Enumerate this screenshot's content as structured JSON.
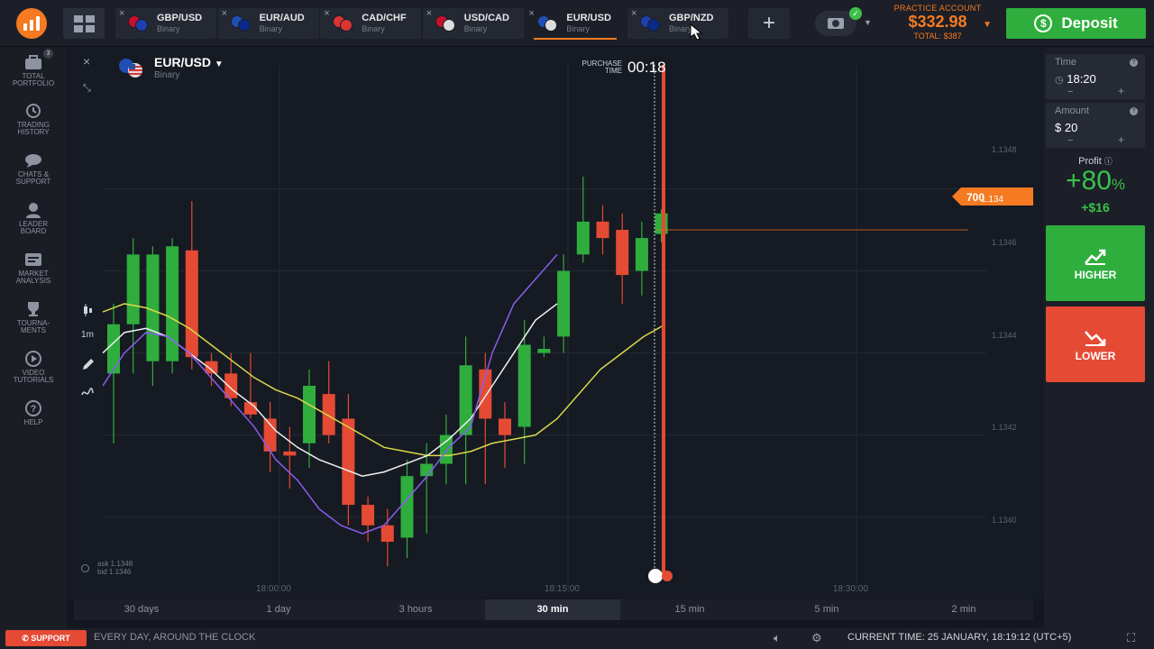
{
  "topbar": {
    "tabs": [
      {
        "name": "GBP/USD",
        "type": "Binary",
        "active": false
      },
      {
        "name": "EUR/AUD",
        "type": "Binary",
        "active": false
      },
      {
        "name": "CAD/CHF",
        "type": "Binary",
        "active": false
      },
      {
        "name": "USD/CAD",
        "type": "Binary",
        "active": false
      },
      {
        "name": "EUR/USD",
        "type": "Binary",
        "active": true
      },
      {
        "name": "GBP/NZD",
        "type": "Binary",
        "active": false
      }
    ],
    "close_glyph": "×",
    "plus_glyph": "+",
    "account": {
      "label": "PRACTICE ACCOUNT",
      "balance": "$332.98",
      "total": "TOTAL: $387"
    },
    "deposit_label": "Deposit"
  },
  "sidebar": {
    "items": [
      {
        "label": "TOTAL\nPORTFOLIO",
        "icon": "portfolio-icon",
        "badge": "3"
      },
      {
        "label": "TRADING\nHISTORY",
        "icon": "history-icon"
      },
      {
        "label": "CHATS &\nSUPPORT",
        "icon": "chat-icon"
      },
      {
        "label": "LEADER\nBOARD",
        "icon": "leaderboard-icon"
      },
      {
        "label": "MARKET\nANALYSIS",
        "icon": "market-analysis-icon"
      },
      {
        "label": "TOURNA-\nMENTS",
        "icon": "trophy-icon"
      },
      {
        "label": "VIDEO\nTUTORIALS",
        "icon": "play-icon"
      },
      {
        "label": "HELP",
        "icon": "help-icon"
      }
    ]
  },
  "chart_header": {
    "pair": "EUR/USD",
    "type": "Binary",
    "purchase_time_label": "PURCHASE\nTIME",
    "countdown": "00:18",
    "tool_timeframe": "1m",
    "ask": "ask 1.1348",
    "bid": "bid 1.1346",
    "current_price_prefix": "1.134",
    "current_price_suffix": "700"
  },
  "colors": {
    "up": "#2fae3d",
    "down": "#e44a34",
    "accent": "#f57a21",
    "ma_yellow": "#d9d94a",
    "ma_white": "#f0f0f0",
    "ma_purple": "#8a5cf0"
  },
  "chart_data": {
    "type": "candlestick",
    "x_ticks": [
      "18:00:00",
      "18:15:00",
      "18:30:00"
    ],
    "y_ticks": [
      "1.1348",
      "1.1346",
      "1.1344",
      "1.1342",
      "1.1340"
    ],
    "ylim": [
      1.13385,
      1.13508
    ],
    "candles": [
      {
        "o": 1.13435,
        "h": 1.13452,
        "l": 1.13418,
        "c": 1.13447
      },
      {
        "o": 1.13447,
        "h": 1.13468,
        "l": 1.13435,
        "c": 1.13464
      },
      {
        "o": 1.13438,
        "h": 1.13466,
        "l": 1.13432,
        "c": 1.13464
      },
      {
        "o": 1.13438,
        "h": 1.13468,
        "l": 1.13435,
        "c": 1.13466
      },
      {
        "o": 1.13465,
        "h": 1.13477,
        "l": 1.13436,
        "c": 1.13439
      },
      {
        "o": 1.13438,
        "h": 1.1344,
        "l": 1.13432,
        "c": 1.13435
      },
      {
        "o": 1.13435,
        "h": 1.1344,
        "l": 1.13427,
        "c": 1.13429
      },
      {
        "o": 1.13428,
        "h": 1.1344,
        "l": 1.13424,
        "c": 1.13425
      },
      {
        "o": 1.13424,
        "h": 1.13428,
        "l": 1.13411,
        "c": 1.13416
      },
      {
        "o": 1.13416,
        "h": 1.13422,
        "l": 1.13407,
        "c": 1.13415
      },
      {
        "o": 1.13418,
        "h": 1.13436,
        "l": 1.13412,
        "c": 1.13432
      },
      {
        "o": 1.1343,
        "h": 1.13438,
        "l": 1.13418,
        "c": 1.1342
      },
      {
        "o": 1.13424,
        "h": 1.1343,
        "l": 1.13398,
        "c": 1.13403
      },
      {
        "o": 1.13403,
        "h": 1.13405,
        "l": 1.13394,
        "c": 1.13398
      },
      {
        "o": 1.13398,
        "h": 1.13402,
        "l": 1.13388,
        "c": 1.13394
      },
      {
        "o": 1.13395,
        "h": 1.13414,
        "l": 1.1339,
        "c": 1.1341
      },
      {
        "o": 1.1341,
        "h": 1.13418,
        "l": 1.13396,
        "c": 1.13413
      },
      {
        "o": 1.13413,
        "h": 1.13425,
        "l": 1.13408,
        "c": 1.1342
      },
      {
        "o": 1.1342,
        "h": 1.13444,
        "l": 1.13408,
        "c": 1.13437
      },
      {
        "o": 1.13436,
        "h": 1.1344,
        "l": 1.13408,
        "c": 1.13424
      },
      {
        "o": 1.13424,
        "h": 1.13428,
        "l": 1.13412,
        "c": 1.1342
      },
      {
        "o": 1.13422,
        "h": 1.13448,
        "l": 1.13413,
        "c": 1.13442
      },
      {
        "o": 1.1344,
        "h": 1.13444,
        "l": 1.13439,
        "c": 1.13441
      },
      {
        "o": 1.13444,
        "h": 1.13464,
        "l": 1.1344,
        "c": 1.1346
      },
      {
        "o": 1.13464,
        "h": 1.13483,
        "l": 1.13462,
        "c": 1.13472
      },
      {
        "o": 1.13472,
        "h": 1.13476,
        "l": 1.13464,
        "c": 1.13468
      },
      {
        "o": 1.1347,
        "h": 1.13474,
        "l": 1.13452,
        "c": 1.13459
      },
      {
        "o": 1.1346,
        "h": 1.13472,
        "l": 1.13454,
        "c": 1.13468
      },
      {
        "o": 1.13469,
        "h": 1.13475,
        "l": 1.13467,
        "c": 1.13474
      }
    ],
    "current_price": 1.1347,
    "ma_lines": {
      "yellow": [
        1.1345,
        1.13452,
        1.13451,
        1.13449,
        1.13446,
        1.13442,
        1.13438,
        1.13434,
        1.13431,
        1.13429,
        1.13426,
        1.13423,
        1.1342,
        1.13417,
        1.13416,
        1.13415,
        1.13415,
        1.13416,
        1.13418,
        1.13419,
        1.1342,
        1.13424,
        1.1343,
        1.13436,
        1.1344,
        1.13444,
        1.13447
      ],
      "white": [
        1.1344,
        1.13445,
        1.13446,
        1.13444,
        1.1344,
        1.13436,
        1.13431,
        1.13427,
        1.13421,
        1.13417,
        1.13414,
        1.13412,
        1.1341,
        1.13411,
        1.13413,
        1.13415,
        1.13419,
        1.13424,
        1.13432,
        1.1344,
        1.13448,
        1.13452
      ],
      "purple": [
        1.13432,
        1.1344,
        1.13445,
        1.13444,
        1.1344,
        1.13434,
        1.13428,
        1.13422,
        1.13414,
        1.13409,
        1.13402,
        1.13398,
        1.13396,
        1.13398,
        1.13404,
        1.1341,
        1.13417,
        1.13422,
        1.1344,
        1.13452,
        1.13458,
        1.13464
      ]
    }
  },
  "timeframes": [
    {
      "label": "30 days",
      "active": false
    },
    {
      "label": "1 day",
      "active": false
    },
    {
      "label": "3 hours",
      "active": false
    },
    {
      "label": "30 min",
      "active": true
    },
    {
      "label": "15 min",
      "active": false
    },
    {
      "label": "5 min",
      "active": false
    },
    {
      "label": "2 min",
      "active": false
    }
  ],
  "right_panel": {
    "time_label": "Time",
    "time_value": "18:20",
    "amount_label": "Amount",
    "amount_value": "$ 20",
    "minus": "−",
    "plus": "+",
    "profit_label": "Profit",
    "profit_pct": "+80",
    "profit_pct_sign": "%",
    "profit_usd": "+$16",
    "higher_label": "HIGHER",
    "lower_label": "LOWER"
  },
  "statusbar": {
    "support_label": "SUPPORT",
    "tagline": "EVERY DAY, AROUND THE CLOCK",
    "current_time": "CURRENT TIME: 25 JANUARY, 18:19:12 (UTC+5)"
  }
}
